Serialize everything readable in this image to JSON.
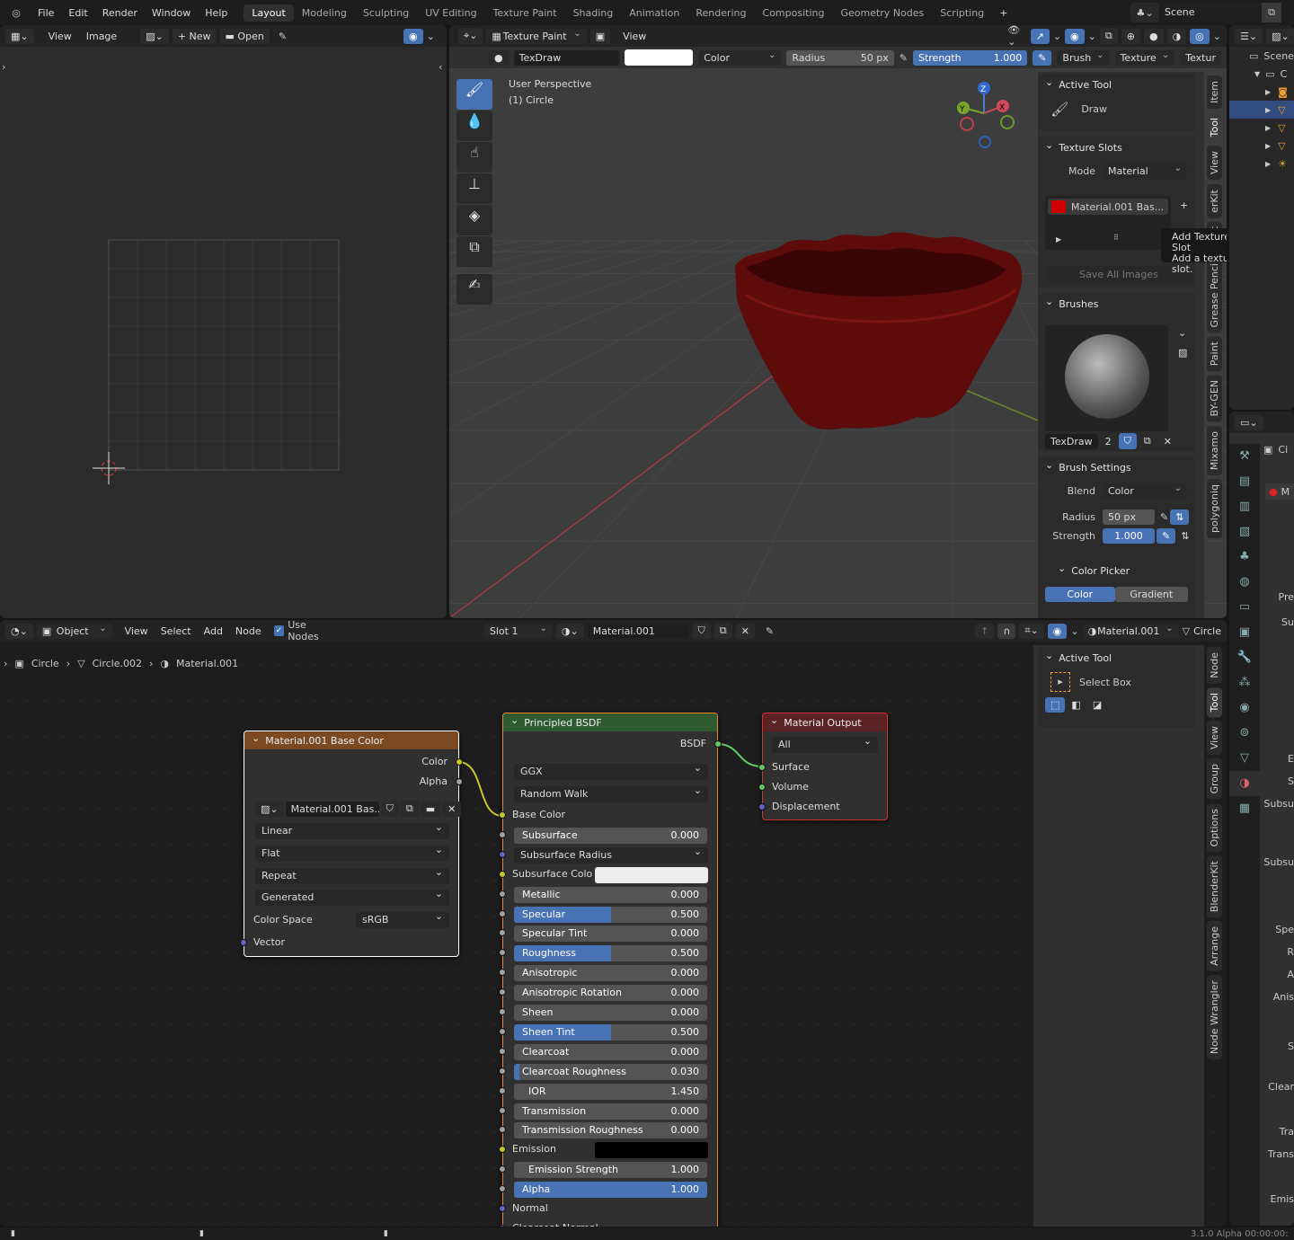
{
  "topbar": {
    "menus": [
      "File",
      "Edit",
      "Render",
      "Window",
      "Help"
    ],
    "workspaces": [
      "Layout",
      "Modeling",
      "Sculpting",
      "UV Editing",
      "Texture Paint",
      "Shading",
      "Animation",
      "Rendering",
      "Compositing",
      "Geometry Nodes",
      "Scripting"
    ],
    "active_workspace": "Layout",
    "add_tab": "+",
    "scene": "Scene"
  },
  "image_editor": {
    "menus": [
      "View",
      "Image"
    ],
    "new_label": "New",
    "open_label": "Open"
  },
  "viewport": {
    "mode": "Texture Paint",
    "view_menu": "View",
    "brush_name": "TexDraw",
    "blend": "Color",
    "radius_label": "Radius",
    "radius_value": "50 px",
    "strength_label": "Strength",
    "strength_value": "1.000",
    "brush_menu": "Brush",
    "texture_menu": "Texture",
    "texture_slot_menu": "Textur",
    "overlay_title": "User Perspective",
    "overlay_object": "(1) Circle",
    "gizmo": {
      "z": "Z",
      "y": "Y",
      "x": "X"
    },
    "brush_color": "#ffffff",
    "object_color": "#6b0d0d"
  },
  "viewport_sidebar": {
    "tabs": [
      "Item",
      "Tool",
      "View",
      "erKit",
      "Edit",
      "Grease Pencil",
      "Paint",
      "BY-GEN",
      "Mixamo",
      "polygoniq"
    ],
    "active_tab": "Tool",
    "active_tool_title": "Active Tool",
    "active_tool": "Draw",
    "texture_slots_title": "Texture Slots",
    "mode_label": "Mode",
    "mode_value": "Material",
    "slot_name": "Material.001 Bas...",
    "slot_color": "#d00000",
    "add": "+",
    "save_all": "Save All Images",
    "brushes_title": "Brushes",
    "brush_name": "TexDraw",
    "brush_users": "2",
    "brush_settings_title": "Brush Settings",
    "blend_label": "Blend",
    "blend_value": "Color",
    "radius_label": "Radius",
    "radius_value": "50 px",
    "strength_label": "Strength",
    "strength_value": "1.000",
    "color_picker_title": "Color Picker",
    "color_tab": "Color",
    "gradient_tab": "Gradient",
    "tooltip_title": "Add Texture Paint Slot",
    "tooltip_desc": "Add a texture paint slot."
  },
  "outliner": {
    "root": "Scene",
    "collection": "C"
  },
  "properties": {
    "object": "Ci",
    "material": "M",
    "labels": [
      "Pre",
      "Su",
      "E",
      "S",
      "Subsu",
      "Subsu",
      "Spe",
      "R",
      "A",
      "Anis",
      "S",
      "Clear",
      "Tra",
      "Trans",
      "Emis"
    ]
  },
  "node_editor": {
    "object_mode": "Object",
    "menus": [
      "View",
      "Select",
      "Add",
      "Node"
    ],
    "use_nodes_label": "Use Nodes",
    "use_nodes": true,
    "slot": "Slot 1",
    "material": "Material.001",
    "header_material": "Material.001",
    "header_object": "Circle",
    "breadcrumb": [
      "Circle",
      "Circle.002",
      "Material.001"
    ],
    "sidebar_tabs": [
      "Node",
      "Tool",
      "View",
      "Group",
      "Options",
      "BlenderKit",
      "Arrange",
      "Node Wrangler"
    ],
    "active_tab": "Tool",
    "active_tool_title": "Active Tool",
    "active_tool": "Select Box"
  },
  "nodes": {
    "image_texture": {
      "title": "Material.001 Base Color",
      "header_color": "#7b4a22",
      "outputs": [
        "Color",
        "Alpha"
      ],
      "image": "Material.001 Bas...",
      "interpolation": "Linear",
      "projection": "Flat",
      "extension": "Repeat",
      "source": "Generated",
      "color_space_label": "Color Space",
      "color_space": "sRGB",
      "input": "Vector"
    },
    "principled": {
      "title": "Principled BSDF",
      "header_color": "#2f5a2f",
      "output": "BSDF",
      "distribution": "GGX",
      "subsurface_method": "Random Walk",
      "inputs": [
        {
          "label": "Base Color",
          "kind": "label",
          "socket": "color"
        },
        {
          "label": "Subsurface",
          "kind": "factor",
          "value": "0.000",
          "fill": 0,
          "socket": "float"
        },
        {
          "label": "Subsurface Radius",
          "kind": "dropdown",
          "socket": "vector"
        },
        {
          "label": "Subsurface Colo",
          "kind": "swatch",
          "swatch": "#eeeeee",
          "socket": "color"
        },
        {
          "label": "Metallic",
          "kind": "factor",
          "value": "0.000",
          "fill": 0,
          "socket": "float"
        },
        {
          "label": "Specular",
          "kind": "factor",
          "value": "0.500",
          "fill": 0.5,
          "socket": "float"
        },
        {
          "label": "Specular Tint",
          "kind": "factor",
          "value": "0.000",
          "fill": 0,
          "socket": "float"
        },
        {
          "label": "Roughness",
          "kind": "factor",
          "value": "0.500",
          "fill": 0.5,
          "socket": "float"
        },
        {
          "label": "Anisotropic",
          "kind": "factor",
          "value": "0.000",
          "fill": 0,
          "socket": "float"
        },
        {
          "label": "Anisotropic Rotation",
          "kind": "factor",
          "value": "0.000",
          "fill": 0,
          "socket": "float"
        },
        {
          "label": "Sheen",
          "kind": "factor",
          "value": "0.000",
          "fill": 0,
          "socket": "float"
        },
        {
          "label": "Sheen Tint",
          "kind": "factor",
          "value": "0.500",
          "fill": 0.5,
          "socket": "float"
        },
        {
          "label": "Clearcoat",
          "kind": "factor",
          "value": "0.000",
          "fill": 0,
          "socket": "float"
        },
        {
          "label": "Clearcoat Roughness",
          "kind": "factor",
          "value": "0.030",
          "fill": 0.03,
          "socket": "float"
        },
        {
          "label": "IOR",
          "kind": "number",
          "value": "1.450",
          "socket": "float"
        },
        {
          "label": "Transmission",
          "kind": "factor",
          "value": "0.000",
          "fill": 0,
          "socket": "float"
        },
        {
          "label": "Transmission Roughness",
          "kind": "factor",
          "value": "0.000",
          "fill": 0,
          "socket": "float"
        },
        {
          "label": "Emission",
          "kind": "swatch",
          "swatch": "#000000",
          "socket": "color"
        },
        {
          "label": "Emission Strength",
          "kind": "number",
          "value": "1.000",
          "socket": "float"
        },
        {
          "label": "Alpha",
          "kind": "factor",
          "value": "1.000",
          "fill": 1,
          "socket": "float"
        },
        {
          "label": "Normal",
          "kind": "label",
          "socket": "vector"
        },
        {
          "label": "Clearcoat Normal",
          "kind": "label",
          "socket": "vector"
        }
      ]
    },
    "material_output": {
      "title": "Material Output",
      "header_color": "#5a2222",
      "target": "All",
      "inputs": [
        "Surface",
        "Volume",
        "Displacement"
      ]
    }
  },
  "socket_colors": {
    "color": "#c7c729",
    "float": "#a1a1a1",
    "vector": "#6363c7",
    "shader": "#63c763"
  },
  "status": {
    "version": "3.1.0 Alpha  00:00:00:"
  }
}
